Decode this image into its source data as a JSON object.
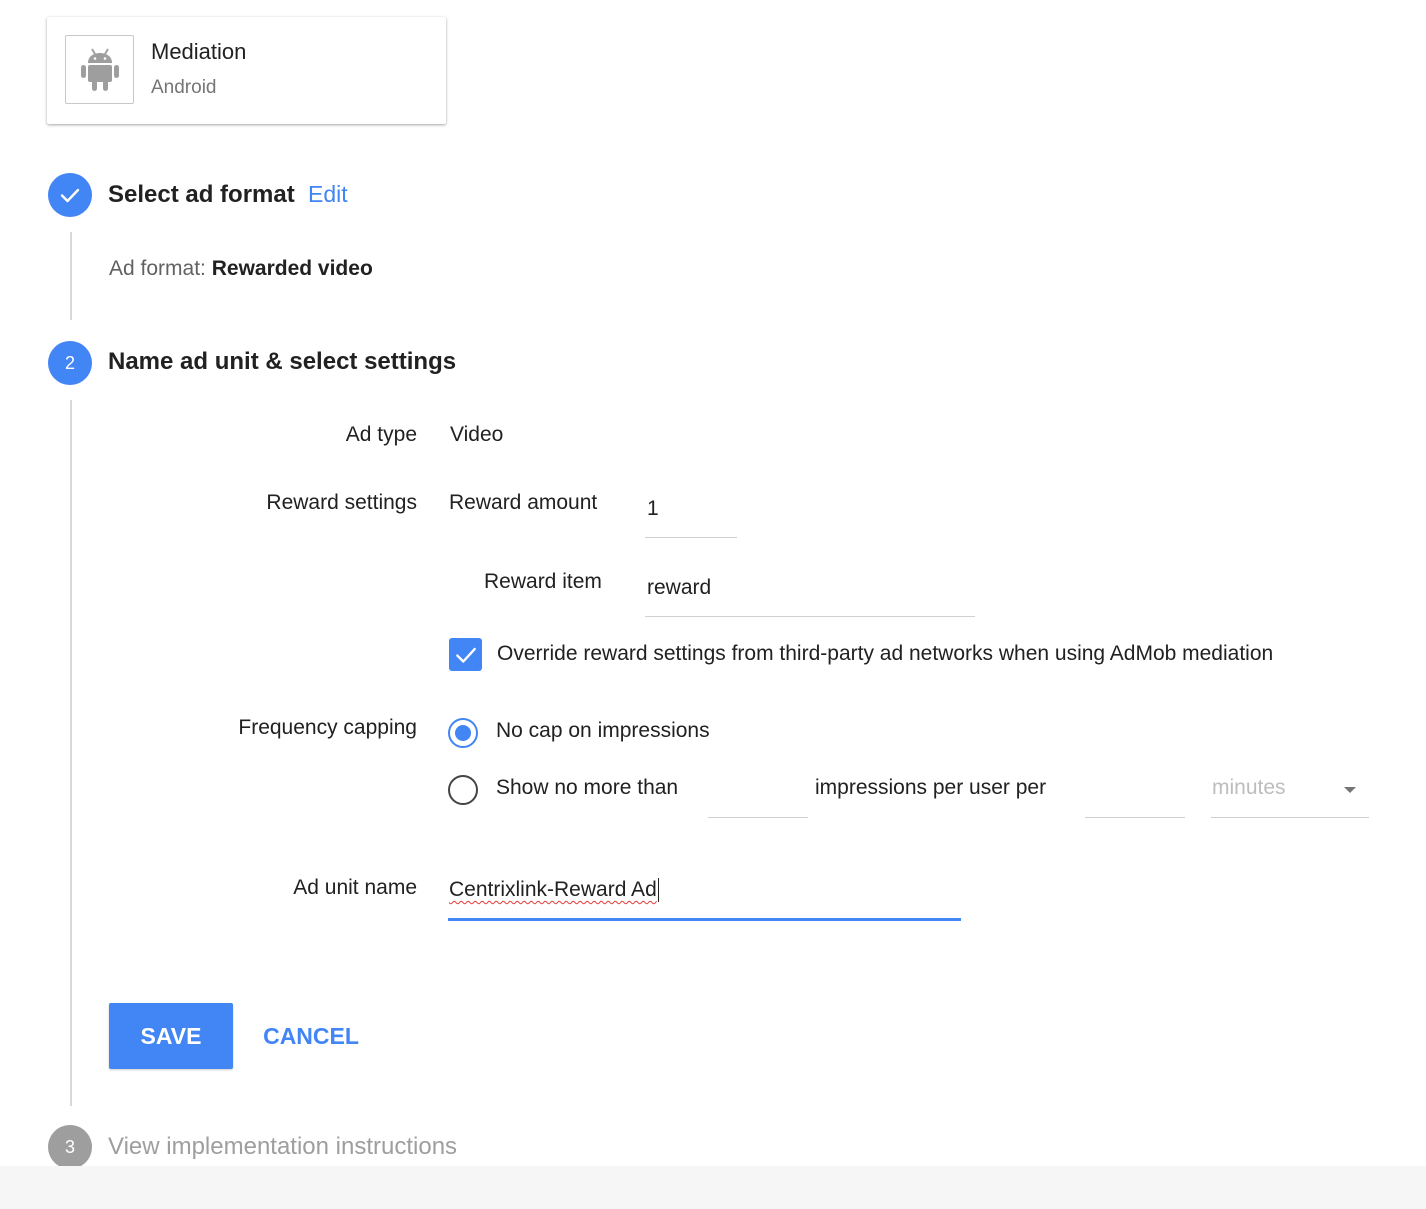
{
  "app": {
    "name": "Mediation",
    "platform": "Android",
    "icon": "android-icon"
  },
  "steps": [
    {
      "number": "",
      "status": "complete",
      "title": "Select ad format",
      "action": "Edit"
    },
    {
      "number": "2",
      "status": "active",
      "title": "Name ad unit & select settings"
    },
    {
      "number": "3",
      "status": "inactive",
      "title": "View implementation instructions"
    }
  ],
  "ad_format": {
    "label": "Ad format:",
    "value": "Rewarded video"
  },
  "settings": {
    "ad_type": {
      "label": "Ad type",
      "value": "Video"
    },
    "reward": {
      "label": "Reward settings",
      "amount_label": "Reward amount",
      "amount_value": "1",
      "item_label": "Reward item",
      "item_value": "reward",
      "override_checked": true,
      "override_label": "Override reward settings from third-party ad networks when using AdMob mediation"
    },
    "frequency": {
      "label": "Frequency capping",
      "option_no_cap": "No cap on impressions",
      "option_limit_prefix": "Show no more than",
      "option_limit_middle": "impressions per user per",
      "impressions_value": "",
      "period_value": "",
      "unit_placeholder": "minutes",
      "selected": "no_cap"
    },
    "ad_unit_name": {
      "label": "Ad unit name",
      "value": "Centrixlink-Reward Ad"
    }
  },
  "buttons": {
    "save": "SAVE",
    "cancel": "CANCEL"
  },
  "colors": {
    "accent": "#4285f4",
    "inactive": "#9e9e9e",
    "text": "#212121",
    "muted": "#757575"
  }
}
